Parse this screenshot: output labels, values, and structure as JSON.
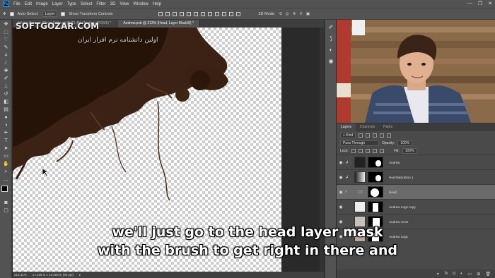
{
  "app": {
    "logo": "Ps"
  },
  "menu": [
    "File",
    "Edit",
    "Image",
    "Layer",
    "Type",
    "Select",
    "Filter",
    "3D",
    "View",
    "Window",
    "Help"
  ],
  "window_controls": [
    "—",
    "❐",
    "✕"
  ],
  "options_bar": {
    "auto_select_label": "Auto-Select:",
    "auto_select_value": "Layer",
    "show_transform_label": "Show Transform Controls",
    "mode_3d_label": "3D Mode:"
  },
  "doc_tabs": [
    {
      "label": "Water Rescue_Clean Edit.psd @ 73.4% (Andrew, RGB/8) *",
      "active": false
    },
    {
      "label": "Andrew.psb @ 213% (Head, Layer Mask/8) *",
      "active": true
    }
  ],
  "tools": [
    "move-icon",
    "marquee-icon",
    "lasso-icon",
    "quick-select-icon",
    "crop-icon",
    "eyedropper-icon",
    "healing-icon",
    "brush-icon",
    "stamp-icon",
    "history-brush-icon",
    "eraser-icon",
    "gradient-icon",
    "blur-icon",
    "dodge-icon",
    "pen-icon",
    "type-icon",
    "path-select-icon",
    "shape-icon",
    "hand-icon",
    "zoom-icon"
  ],
  "status_bar": {
    "zoom": "213.41%",
    "dimensions": "17.188 in x 13.906 in (96 ppi)"
  },
  "watermark": {
    "line1": "SOFTGOZAR.COM",
    "line2": "اولین دانشنامه نرم افزار ایران"
  },
  "layers_panel": {
    "tabs": [
      {
        "label": "Layers",
        "active": true
      },
      {
        "label": "Channels",
        "active": false
      },
      {
        "label": "Paths",
        "active": false
      }
    ],
    "kind_label": "Kind",
    "blend_mode": "Pass Through",
    "opacity_label": "Opacity:",
    "opacity_value": "100%",
    "lock_label": "Lock:",
    "fill_label": "Fill:",
    "fill_value": "100%",
    "layers": [
      {
        "name": "Andrew",
        "selected": false
      },
      {
        "name": "Hue/Saturation 1",
        "selected": false
      },
      {
        "name": "Head",
        "selected": true
      },
      {
        "name": "Andrew Legs copy",
        "selected": false
      },
      {
        "name": "Andrew Arms",
        "selected": false
      },
      {
        "name": "Andrew Legs",
        "selected": false
      }
    ],
    "bottom_icons": [
      "link-icon",
      "fx-icon",
      "mask-icon",
      "adjustment-icon",
      "folder-icon",
      "new-layer-icon",
      "trash-icon"
    ]
  },
  "subtitles": {
    "line1": "we'll just go to the head layer mask",
    "line2": "with the brush to get right in there and"
  }
}
